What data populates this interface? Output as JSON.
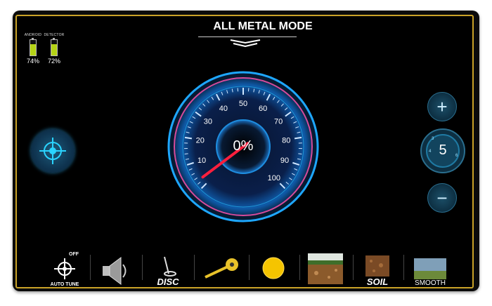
{
  "status": {
    "android": {
      "label": "ANDROID",
      "percent": "74%",
      "level": 0.74
    },
    "detector": {
      "label": "DETECTOR",
      "percent": "72%",
      "level": 0.72
    }
  },
  "header": {
    "title": "ALL METAL MODE",
    "menu_icon": "chevron-down-icon"
  },
  "gauge": {
    "readout": "0%",
    "ticks": [
      "10",
      "20",
      "30",
      "40",
      "50",
      "60",
      "70",
      "80",
      "90",
      "100"
    ],
    "value": 0,
    "accent": "#1ea7ff",
    "needle": "#ff1f3d"
  },
  "controls": {
    "plus_label": "+",
    "minus_label": "−",
    "level": "5",
    "dial_marks": [
      "3",
      "4",
      "6"
    ]
  },
  "toolbar": {
    "autotune_off": "OFF",
    "autotune_label": "AUTO TUNE",
    "disc_label": "DISC",
    "soil_label": "SOIL",
    "smooth_label": "SMOOTH"
  },
  "colors": {
    "frame": "#c9a227",
    "background": "#000000",
    "battery": "#b5d316"
  }
}
